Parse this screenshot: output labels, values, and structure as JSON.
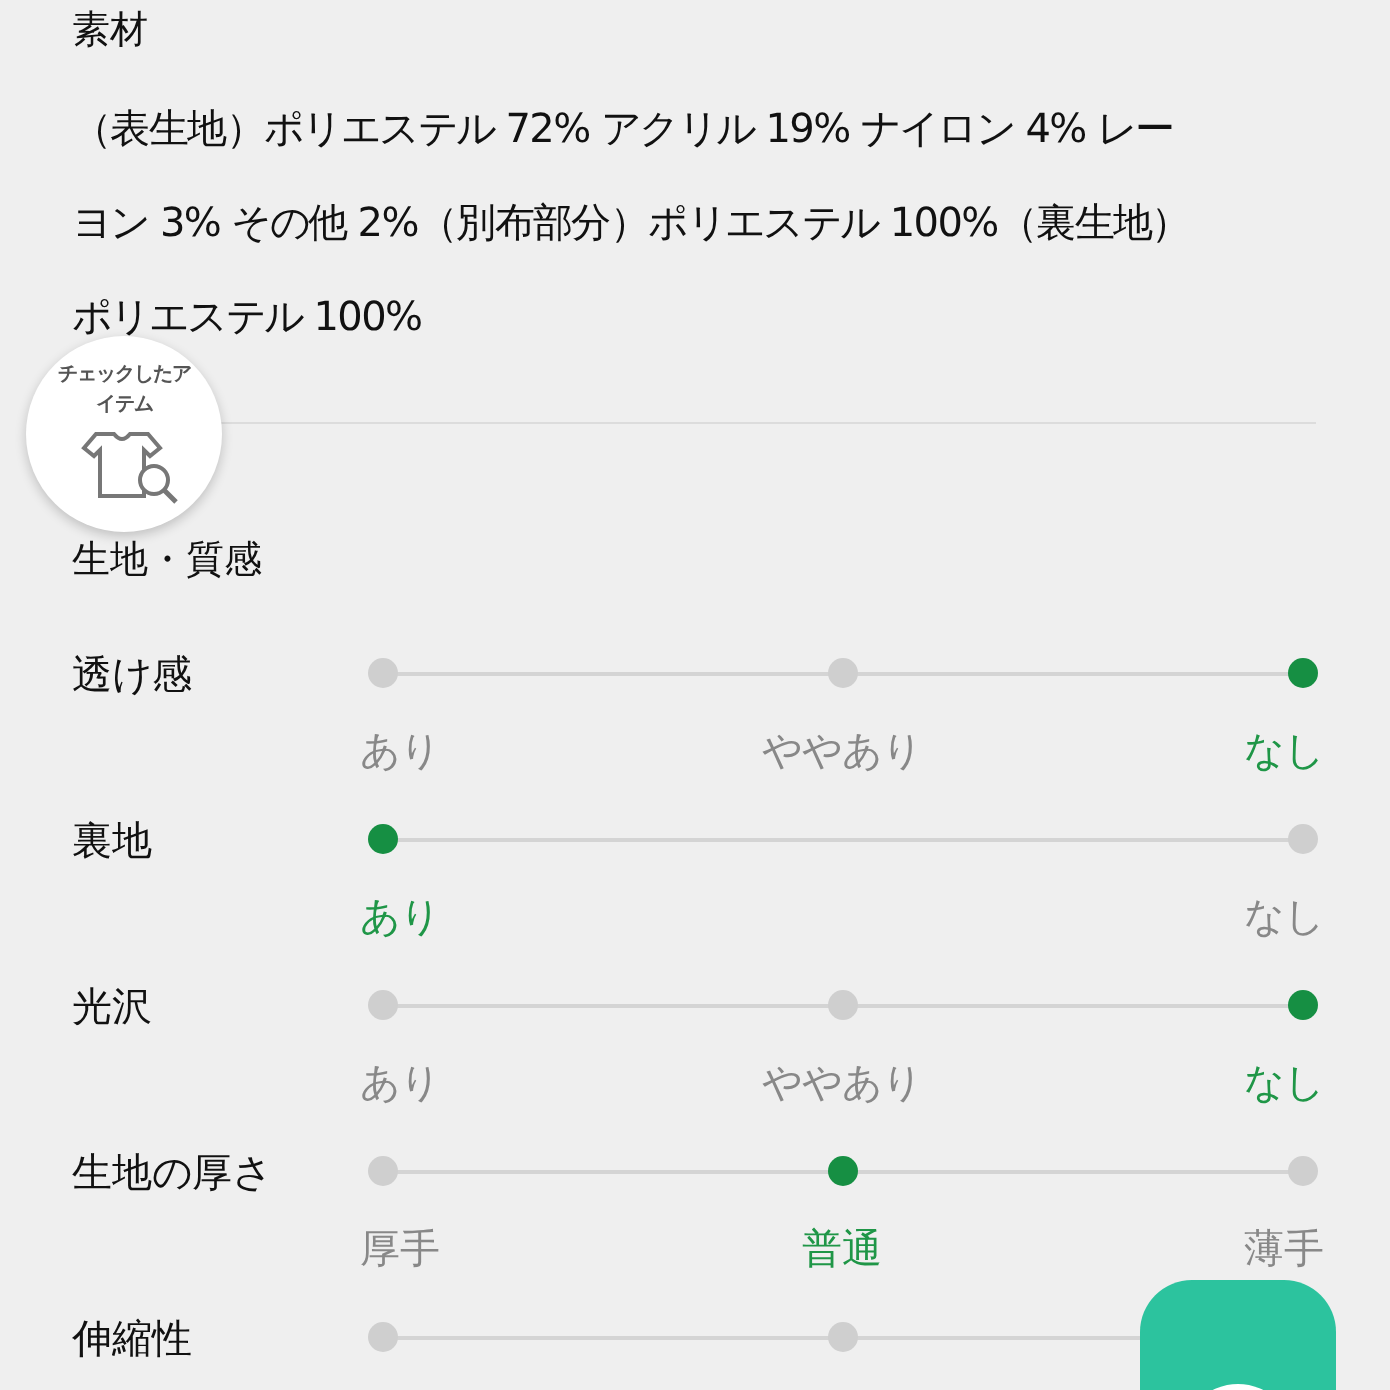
{
  "material": {
    "title": "素材",
    "lines": [
      "（表生地）ポリエステル 72% アクリル 19% ナイロン 4% レー",
      "ヨン 3% その他 2%（別布部分）ポリエステル 100%（裏生地）",
      "ポリエステル 100%"
    ]
  },
  "checked_items": {
    "label": "チェックしたアイテム"
  },
  "texture": {
    "title": "生地・質感",
    "rows": [
      {
        "name": "透け感",
        "kind": "three-step",
        "options": [
          {
            "label": "あり",
            "selected": false
          },
          {
            "label": "ややあり",
            "selected": false
          },
          {
            "label": "なし",
            "selected": true
          }
        ]
      },
      {
        "name": "裏地",
        "kind": "two-step",
        "options": [
          {
            "label": "あり",
            "selected": true
          },
          {
            "label": "なし",
            "selected": false
          }
        ]
      },
      {
        "name": "光沢",
        "kind": "three-step",
        "options": [
          {
            "label": "あり",
            "selected": false
          },
          {
            "label": "ややあり",
            "selected": false
          },
          {
            "label": "なし",
            "selected": true
          }
        ]
      },
      {
        "name": "生地の厚さ",
        "kind": "three-step",
        "options": [
          {
            "label": "厚手",
            "selected": false
          },
          {
            "label": "普通",
            "selected": true
          },
          {
            "label": "薄手",
            "selected": false
          }
        ]
      },
      {
        "name": "伸縮性",
        "kind": "three-step",
        "options": [
          {
            "selected": false
          },
          {
            "selected": false
          }
        ]
      }
    ]
  }
}
